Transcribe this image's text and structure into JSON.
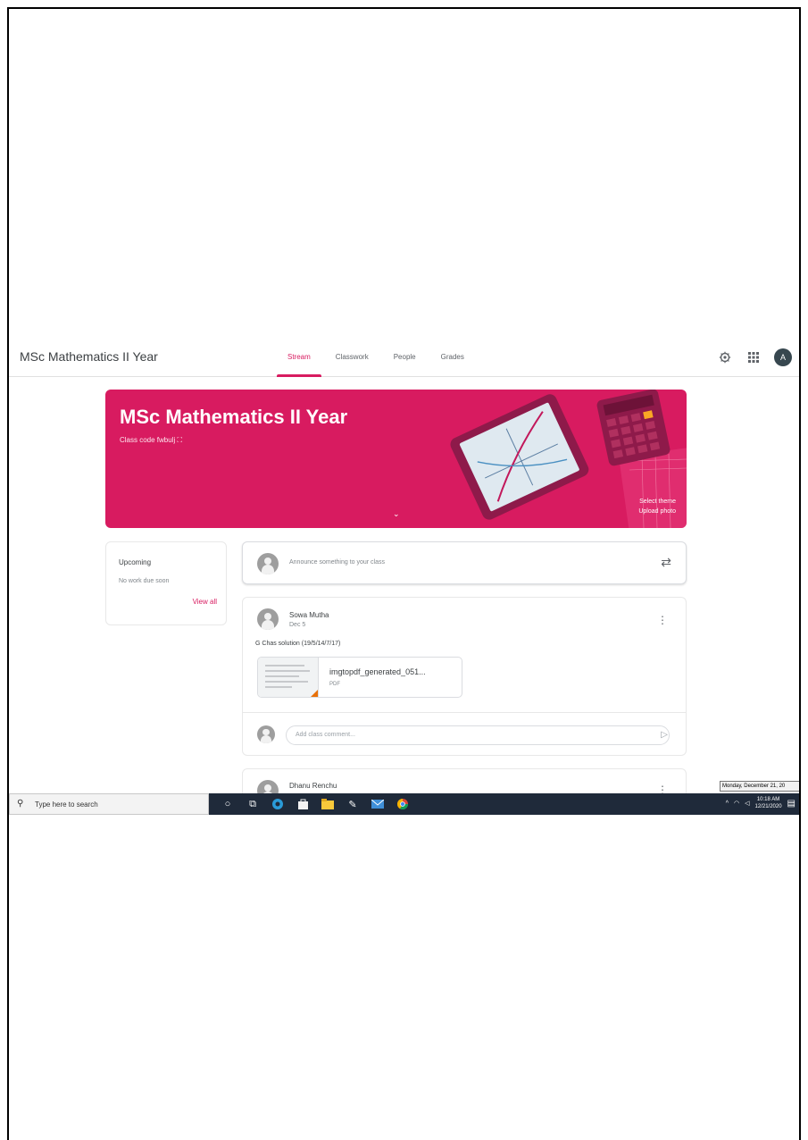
{
  "header": {
    "class_title": "MSc Mathematics II Year",
    "tabs": [
      "Stream",
      "Classwork",
      "People",
      "Grades"
    ],
    "active_tab": "Stream",
    "icons": [
      "settings-icon",
      "apps-grid-icon"
    ],
    "account_initial": "A"
  },
  "banner": {
    "title": "MSc Mathematics II Year",
    "class_code": "Class code  fwbulj  ⛶",
    "select_theme": "Select theme",
    "upload_photo": "Upload photo",
    "color": "#d81b60"
  },
  "upcoming": {
    "title": "Upcoming",
    "empty_text": "No work due soon",
    "view_all": "View all"
  },
  "announce": {
    "placeholder": "Announce something to your class"
  },
  "posts": [
    {
      "author": "Sowa Mutha",
      "date": "Dec 5",
      "text": "G Chas solution (19/5/14/7/17)",
      "attachment": {
        "name": "imgtopdf_generated_051...",
        "type": "PDF"
      },
      "comment_placeholder": "Add class comment..."
    },
    {
      "author": "Dhanu Renchu"
    }
  ],
  "tooltip": "Monday, December 21, 20",
  "taskbar": {
    "search_placeholder": "Type here to search",
    "clock_time": "10:18 AM",
    "clock_date": "12/21/2020"
  }
}
